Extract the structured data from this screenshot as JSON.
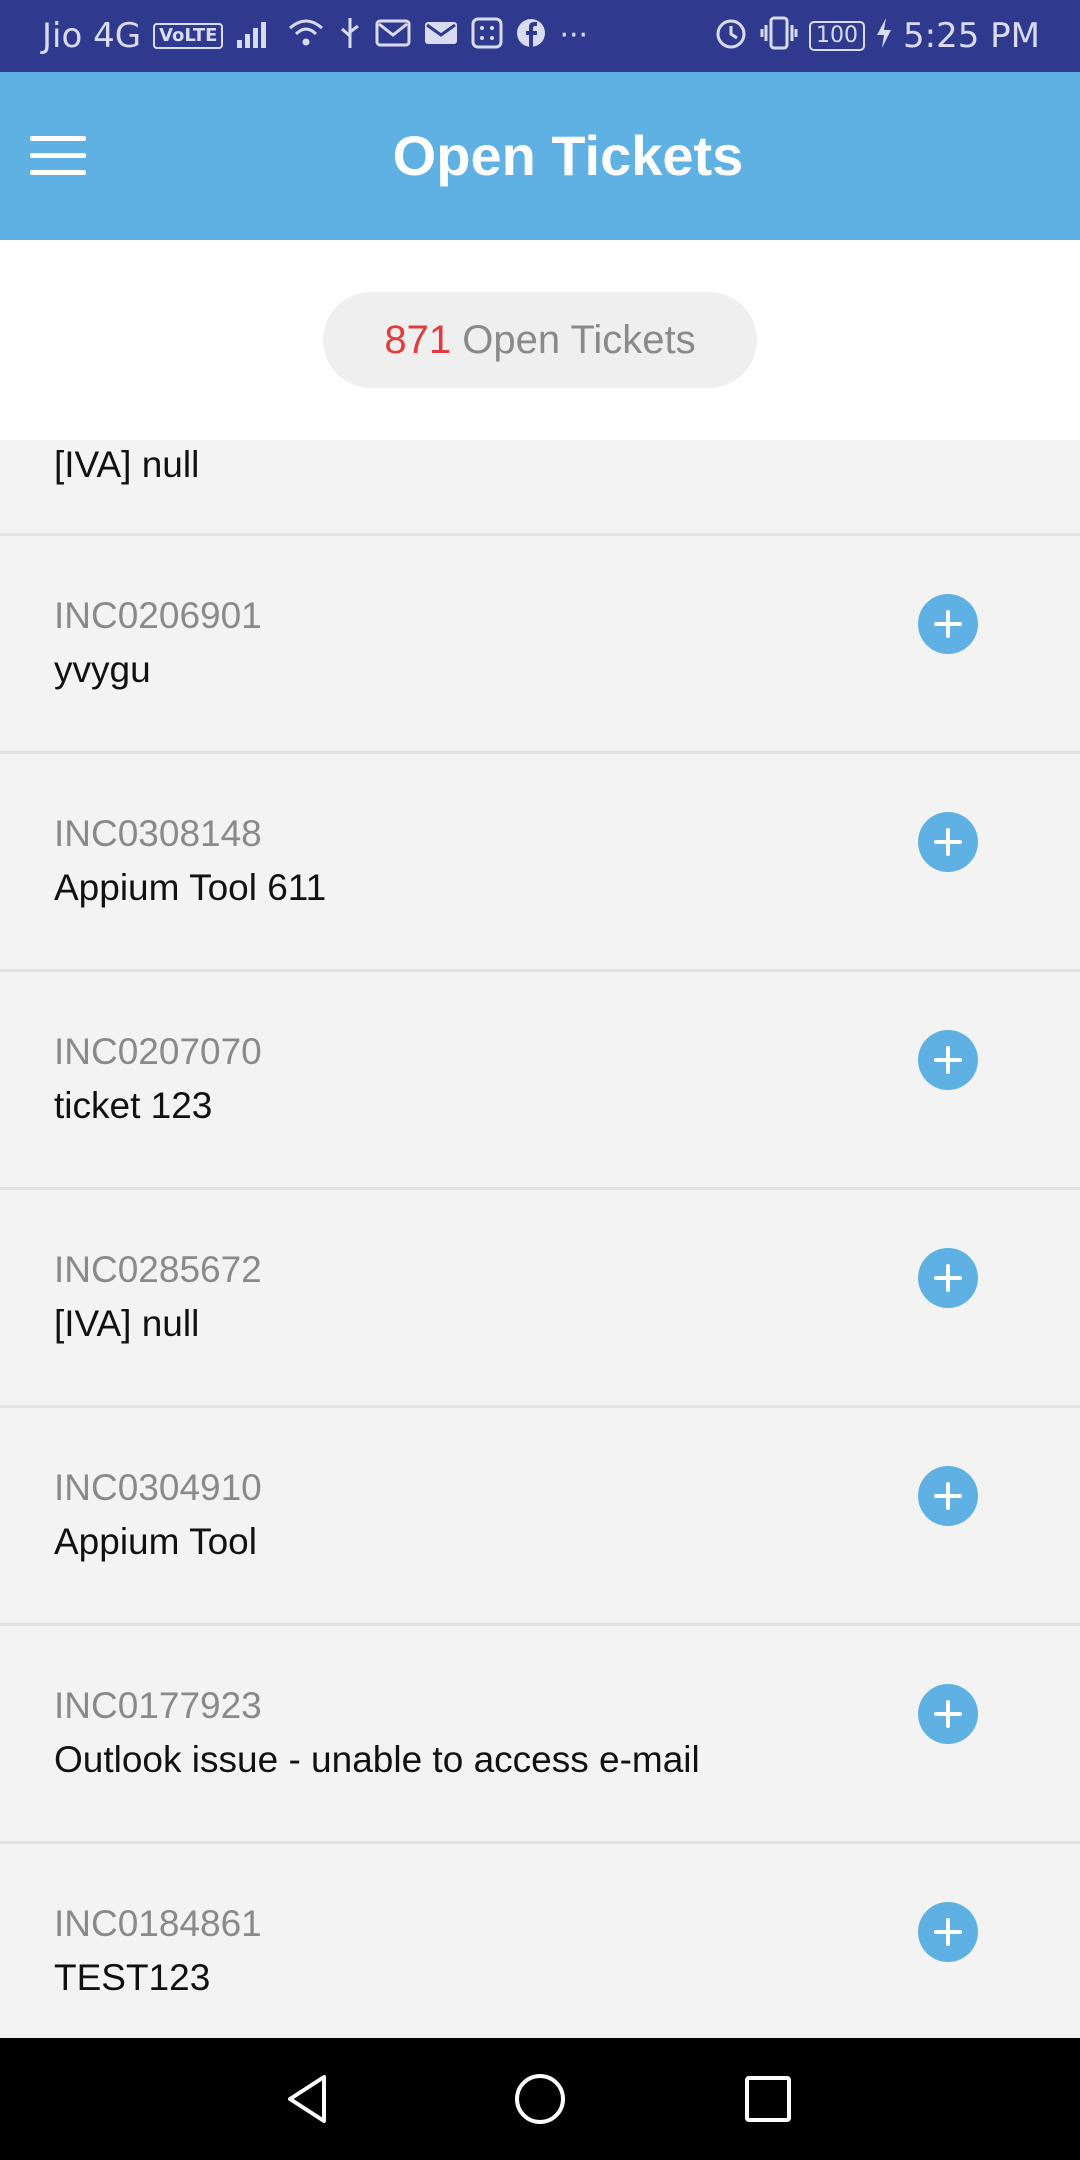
{
  "status_bar": {
    "carrier": "Jio 4G",
    "volte": "VoLTE",
    "battery": "100",
    "time": "5:25 PM",
    "more": "···"
  },
  "app_bar": {
    "title": "Open Tickets",
    "menu_icon": "hamburger-menu-icon",
    "color": "#5eb1e2"
  },
  "summary": {
    "count": "871",
    "label": "Open Tickets",
    "count_color": "#e23b3b"
  },
  "partial_ticket": {
    "description": "[IVA] null"
  },
  "tickets": [
    {
      "id": "INC0206901",
      "description": "yvygu"
    },
    {
      "id": "INC0308148",
      "description": "Appium Tool 611"
    },
    {
      "id": "INC0207070",
      "description": "ticket 123"
    },
    {
      "id": "INC0285672",
      "description": "[IVA] null"
    },
    {
      "id": "INC0304910",
      "description": "Appium Tool"
    },
    {
      "id": "INC0177923",
      "description": "Outlook issue - unable to access e-mail"
    },
    {
      "id": "INC0184861",
      "description": "TEST123"
    }
  ],
  "nav_bar": {
    "icons": [
      "back-icon",
      "home-icon",
      "recent-apps-icon"
    ]
  }
}
